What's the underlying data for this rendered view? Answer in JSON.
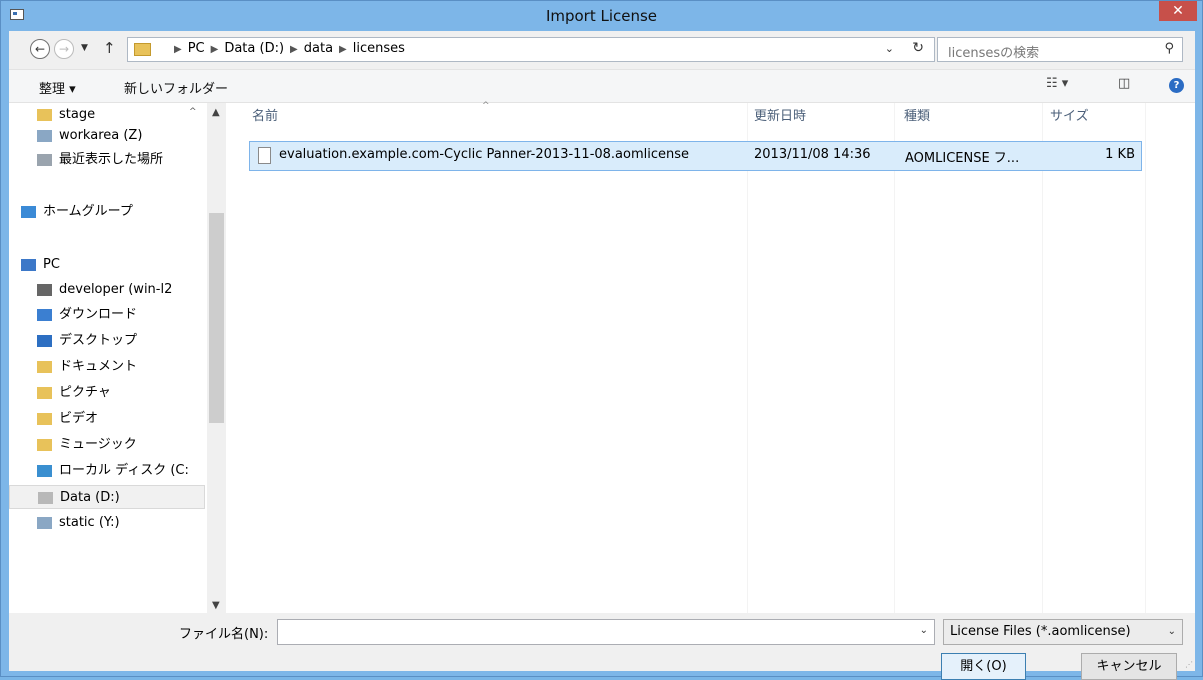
{
  "window": {
    "title": "Import License",
    "close_glyph": "✕"
  },
  "address_bar": {
    "crumbs": [
      "PC",
      "Data (D:)",
      "data",
      "licenses"
    ],
    "search_placeholder": "licensesの検索"
  },
  "toolbar": {
    "organize_label": "整理 ▾",
    "new_folder_label": "新しいフォルダー"
  },
  "nav_pane": {
    "items": [
      {
        "label": "stage",
        "icon": "folder-icon"
      },
      {
        "label": "workarea (Z)",
        "icon": "network-drive-icon"
      },
      {
        "label": "最近表示した場所",
        "icon": "recent-places-icon"
      },
      {
        "label": "ホームグループ",
        "icon": "homegroup-icon"
      },
      {
        "label": "PC",
        "icon": "computer-icon"
      },
      {
        "label": "developer (win-l2",
        "icon": "user-computer-icon"
      },
      {
        "label": "ダウンロード",
        "icon": "downloads-folder-icon"
      },
      {
        "label": "デスクトップ",
        "icon": "desktop-folder-icon"
      },
      {
        "label": "ドキュメント",
        "icon": "documents-folder-icon"
      },
      {
        "label": "ピクチャ",
        "icon": "pictures-folder-icon"
      },
      {
        "label": "ビデオ",
        "icon": "videos-folder-icon"
      },
      {
        "label": "ミュージック",
        "icon": "music-folder-icon"
      },
      {
        "label": "ローカル ディスク (C:",
        "icon": "local-disk-icon"
      },
      {
        "label": "Data (D:)",
        "icon": "drive-icon",
        "selected": true
      },
      {
        "label": "static (Y:)",
        "icon": "network-drive-icon"
      }
    ]
  },
  "file_list": {
    "columns": {
      "name": "名前",
      "modified": "更新日時",
      "type": "種類",
      "size": "サイズ"
    },
    "rows": [
      {
        "name": "evaluation.example.com-Cyclic Panner-2013-11-08.aomlicense",
        "modified": "2013/11/08 14:36",
        "type": "AOMLICENSE フ...",
        "size": "1 KB"
      }
    ]
  },
  "bottom": {
    "filename_label": "ファイル名(N):",
    "filename_value": "",
    "filetype_value": "License Files (*.aomlicense)",
    "open_label": "開く(O)",
    "cancel_label": "キャンセル"
  },
  "colors": {
    "title_bar": "#7db6e8",
    "close_button": "#c7504a",
    "selection": "#d9ecfb",
    "selection_border": "#7eb4ea"
  }
}
